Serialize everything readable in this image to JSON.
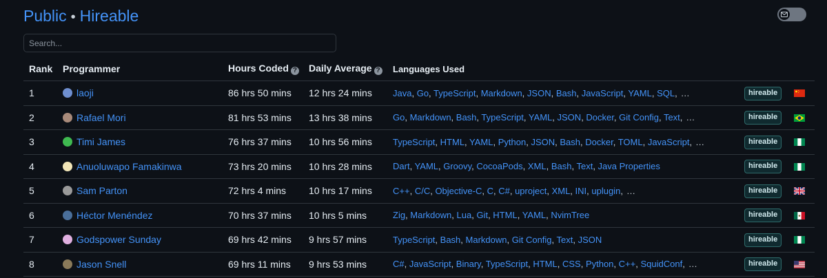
{
  "header": {
    "public_label": "Public",
    "separator": "•",
    "hireable_label": "Hireable"
  },
  "search": {
    "placeholder": "Search..."
  },
  "table": {
    "columns": [
      "Rank",
      "Programmer",
      "Hours Coded",
      "Daily Average",
      "Languages Used"
    ],
    "rows": [
      {
        "rank": "1",
        "name": "laoji",
        "avatar": "#6f8fd0",
        "hours": "86 hrs 50 mins",
        "avg": "12 hrs 24 mins",
        "langs": [
          "Java",
          "Go",
          "TypeScript",
          "Markdown",
          "JSON",
          "Bash",
          "JavaScript",
          "YAML",
          "SQL"
        ],
        "more": true,
        "badge": "hireable",
        "flag": "cn"
      },
      {
        "rank": "2",
        "name": "Rafael Mori",
        "avatar": "#a88a7a",
        "hours": "81 hrs 53 mins",
        "avg": "13 hrs 38 mins",
        "langs": [
          "Go",
          "Markdown",
          "Bash",
          "TypeScript",
          "YAML",
          "JSON",
          "Docker",
          "Git Config",
          "Text"
        ],
        "more": true,
        "badge": "hireable",
        "flag": "br"
      },
      {
        "rank": "3",
        "name": "Timi James",
        "avatar": "#3fb950",
        "hours": "76 hrs 37 mins",
        "avg": "10 hrs 56 mins",
        "langs": [
          "TypeScript",
          "HTML",
          "YAML",
          "Python",
          "JSON",
          "Bash",
          "Docker",
          "TOML",
          "JavaScript"
        ],
        "more": true,
        "badge": "hireable",
        "flag": "ng"
      },
      {
        "rank": "4",
        "name": "Anuoluwapo Famakinwa",
        "avatar": "#f2e6b8",
        "hours": "73 hrs 20 mins",
        "avg": "10 hrs 28 mins",
        "langs": [
          "Dart",
          "YAML",
          "Groovy",
          "CocoaPods",
          "XML",
          "Bash",
          "Text",
          "Java Properties"
        ],
        "more": false,
        "badge": "hireable",
        "flag": "ng"
      },
      {
        "rank": "5",
        "name": "Sam Parton",
        "avatar": "#9a9a9a",
        "hours": "72 hrs 4 mins",
        "avg": "10 hrs 17 mins",
        "langs": [
          "C++",
          "C/C",
          "Objective-C",
          "C",
          "C#",
          "uproject",
          "XML",
          "INI",
          "uplugin"
        ],
        "more": true,
        "badge": "hireable",
        "flag": "gb"
      },
      {
        "rank": "6",
        "name": "Héctor Menéndez",
        "avatar": "#4a6f9a",
        "hours": "70 hrs 37 mins",
        "avg": "10 hrs 5 mins",
        "langs": [
          "Zig",
          "Markdown",
          "Lua",
          "Git",
          "HTML",
          "YAML",
          "NvimTree"
        ],
        "more": false,
        "badge": "hireable",
        "flag": "mx"
      },
      {
        "rank": "7",
        "name": "Godspower Sunday",
        "avatar": "#e0b0e0",
        "hours": "69 hrs 42 mins",
        "avg": "9 hrs 57 mins",
        "langs": [
          "TypeScript",
          "Bash",
          "Markdown",
          "Git Config",
          "Text",
          "JSON"
        ],
        "more": false,
        "badge": "hireable",
        "flag": "ng"
      },
      {
        "rank": "8",
        "name": "Jason Snell",
        "avatar": "#8a7a5a",
        "hours": "69 hrs 11 mins",
        "avg": "9 hrs 53 mins",
        "langs": [
          "C#",
          "JavaScript",
          "Binary",
          "TypeScript",
          "HTML",
          "CSS",
          "Python",
          "C++",
          "SquidConf"
        ],
        "more": true,
        "badge": "hireable",
        "flag": "us"
      }
    ]
  },
  "ellipsis": "…",
  "help_glyph": "?",
  "colors": {
    "link": "#4493f8",
    "background": "#0d1117",
    "border": "#30363d",
    "badge_bg": "#102a2f"
  }
}
